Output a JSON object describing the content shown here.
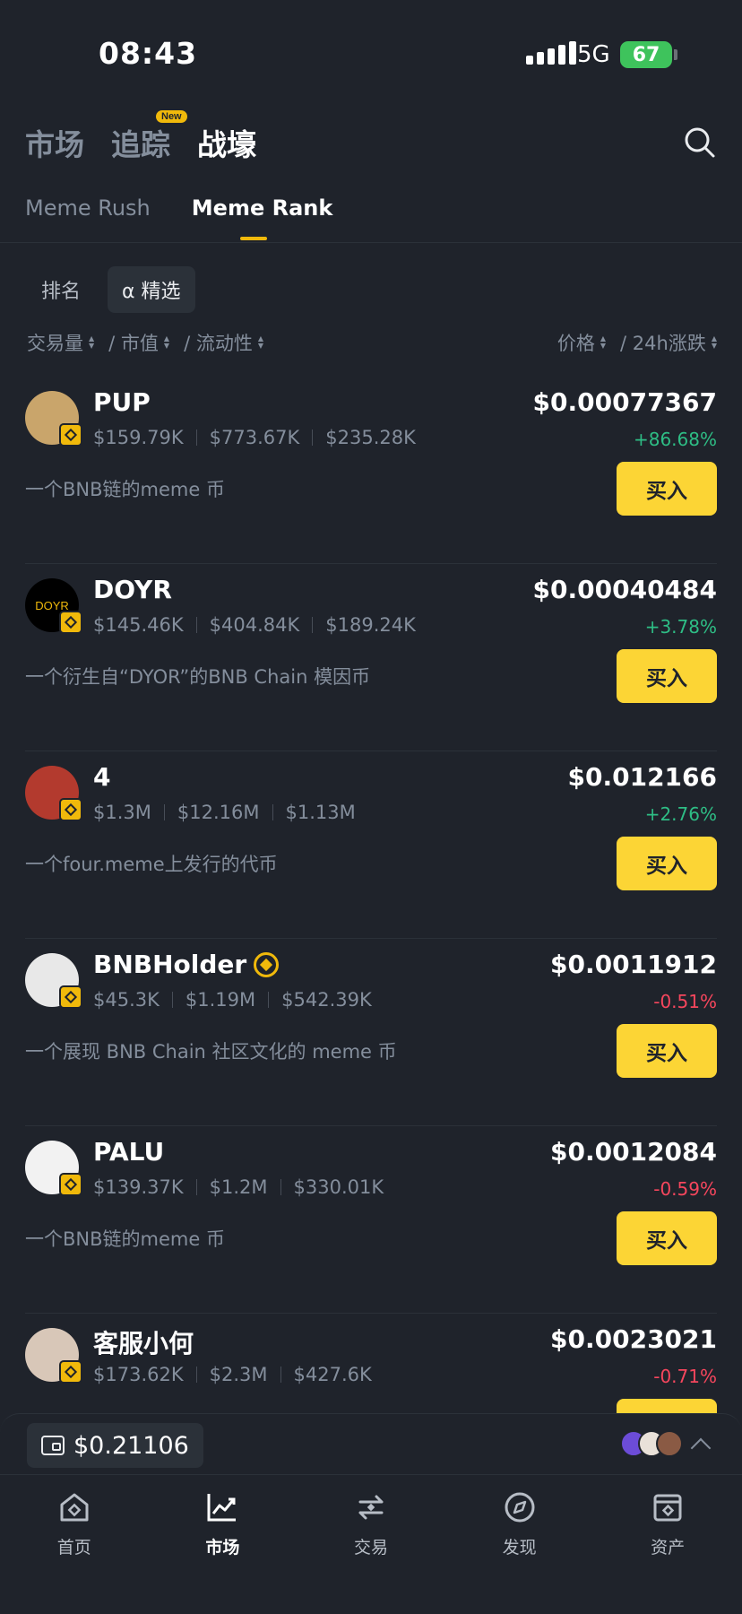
{
  "status": {
    "time": "08:43",
    "network": "5G",
    "battery": "67"
  },
  "top_tabs": [
    {
      "label": "市场",
      "active": false
    },
    {
      "label": "追踪",
      "active": false,
      "badge": "New"
    },
    {
      "label": "战壕",
      "active": true
    }
  ],
  "sub_tabs": [
    {
      "label": "Meme Rush",
      "active": false
    },
    {
      "label": "Meme Rank",
      "active": true
    }
  ],
  "filters": [
    {
      "label": "排名",
      "active": false
    },
    {
      "label": "α 精选",
      "active": true
    }
  ],
  "sort": {
    "left": [
      "交易量",
      "/ 市值",
      "/ 流动性"
    ],
    "right": [
      "价格",
      "/ 24h涨跌"
    ]
  },
  "buy_label": "买入",
  "coins": [
    {
      "name": "PUP",
      "volume": "$159.79K",
      "mcap": "$773.67K",
      "liquidity": "$235.28K",
      "desc": "一个BNB链的meme 币",
      "price": "$0.00077367",
      "change": "+86.68%",
      "dir": "up",
      "avatar_color": "#c9a56b",
      "avatar_text": ""
    },
    {
      "name": "DOYR",
      "volume": "$145.46K",
      "mcap": "$404.84K",
      "liquidity": "$189.24K",
      "desc": "一个衍生自“DYOR”的BNB Chain 模因币",
      "price": "$0.00040484",
      "change": "+3.78%",
      "dir": "up",
      "avatar_color": "#000000",
      "avatar_text": "DOYR"
    },
    {
      "name": "4",
      "volume": "$1.3M",
      "mcap": "$12.16M",
      "liquidity": "$1.13M",
      "desc": "一个four.meme上发行的代币",
      "price": "$0.012166",
      "change": "+2.76%",
      "dir": "up",
      "avatar_color": "#b33a2e",
      "avatar_text": ""
    },
    {
      "name": "BNBHolder",
      "verified": true,
      "volume": "$45.3K",
      "mcap": "$1.19M",
      "liquidity": "$542.39K",
      "desc": "一个展现 BNB Chain 社区文化的 meme 币",
      "price": "$0.0011912",
      "change": "-0.51%",
      "dir": "down",
      "avatar_color": "#e8e8e8",
      "avatar_text": ""
    },
    {
      "name": "PALU",
      "volume": "$139.37K",
      "mcap": "$1.2M",
      "liquidity": "$330.01K",
      "desc": "一个BNB链的meme 币",
      "price": "$0.0012084",
      "change": "-0.59%",
      "dir": "down",
      "avatar_color": "#f2f2f2",
      "avatar_text": ""
    },
    {
      "name": "客服小何",
      "volume": "$173.62K",
      "mcap": "$2.3M",
      "liquidity": "$427.6K",
      "desc": "",
      "price": "$0.0023021",
      "change": "-0.71%",
      "dir": "down",
      "avatar_color": "#d8c7b8",
      "avatar_text": ""
    }
  ],
  "wallet": {
    "balance": "$0.21106"
  },
  "bottom_nav": [
    {
      "label": "首页",
      "active": false,
      "icon": "home-icon"
    },
    {
      "label": "市场",
      "active": true,
      "icon": "chart-icon"
    },
    {
      "label": "交易",
      "active": false,
      "icon": "trade-icon"
    },
    {
      "label": "发现",
      "active": false,
      "icon": "discover-icon"
    },
    {
      "label": "资产",
      "active": false,
      "icon": "wallet-icon"
    }
  ],
  "colors": {
    "accent": "#fcd535",
    "up": "#2ebd85",
    "down": "#f6465d",
    "bg": "#1f232b"
  }
}
